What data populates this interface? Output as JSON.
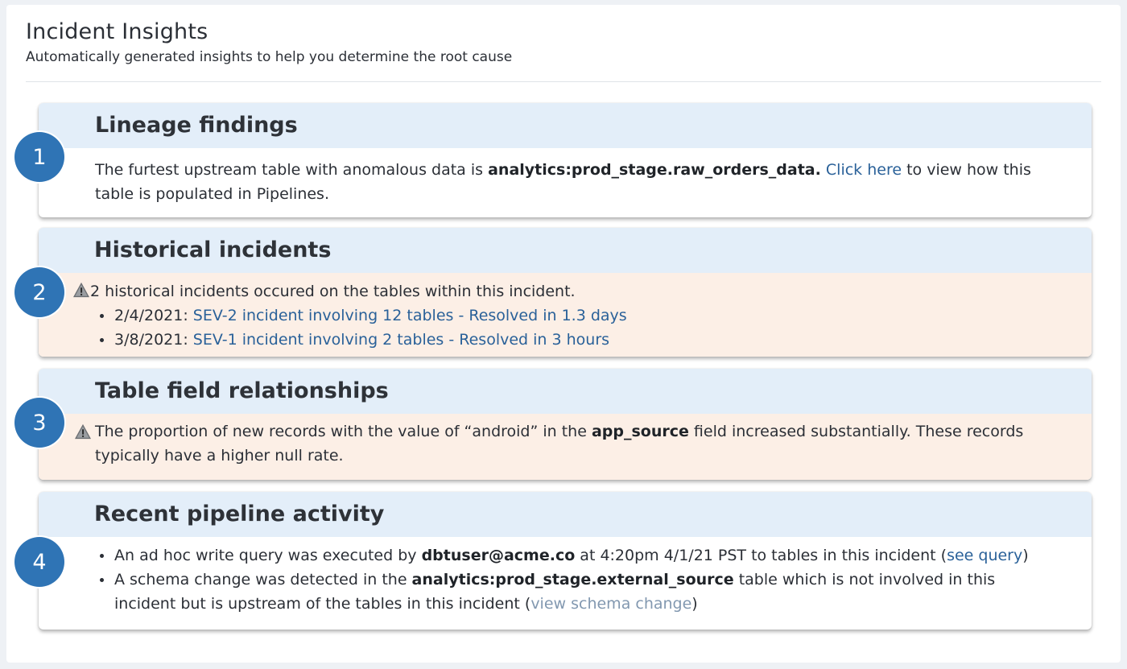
{
  "header": {
    "title": "Incident Insights",
    "subtitle": "Automatically generated insights to help you determine the root cause"
  },
  "cards": [
    {
      "number": "1",
      "title": "Lineage findings",
      "text_before": "The furtest upstream table with anomalous data is ",
      "table": "analytics:prod_stage.raw_orders_data.",
      "link": "Click here",
      "text_after": " to view how this table is populated in Pipelines."
    },
    {
      "number": "2",
      "title": "Historical incidents",
      "summary": "2 historical incidents occured on the tables within this incident.",
      "items": [
        {
          "date": "2/4/2021: ",
          "link": "SEV-2 incident involving 12 tables - Resolved in 1.3 days"
        },
        {
          "date": "3/8/2021: ",
          "link": "SEV-1 incident involving 2 tables - Resolved in 3 hours"
        }
      ]
    },
    {
      "number": "3",
      "title": "Table field relationships",
      "text_before": "The proportion of new records with the value of “android” in the ",
      "field": "app_source",
      "text_after": " field increased substantially. These records typically have a higher null rate."
    },
    {
      "number": "4",
      "title": "Recent pipeline activity",
      "items": [
        {
          "text_before": "An ad hoc write query was executed by ",
          "user": "dbtuser@acme.co",
          "text_middle": " at 4:20pm 4/1/21 PST to tables in this incident (",
          "link": "see query",
          "text_after": ")"
        },
        {
          "text_before": "A schema change was detected in the ",
          "table": "analytics:prod_stage.external_source",
          "text_middle": " table which is not involved in this incident but is upstream of the tables in this incident (",
          "link": "view schema change",
          "text_after": ")"
        }
      ]
    }
  ],
  "colors": {
    "accent": "#2f74b5",
    "card_header_bg": "#e3eef9",
    "warning_bg": "#fcefe6",
    "link": "#2a6199"
  },
  "icons": {
    "warning": "warning-triangle-icon"
  }
}
